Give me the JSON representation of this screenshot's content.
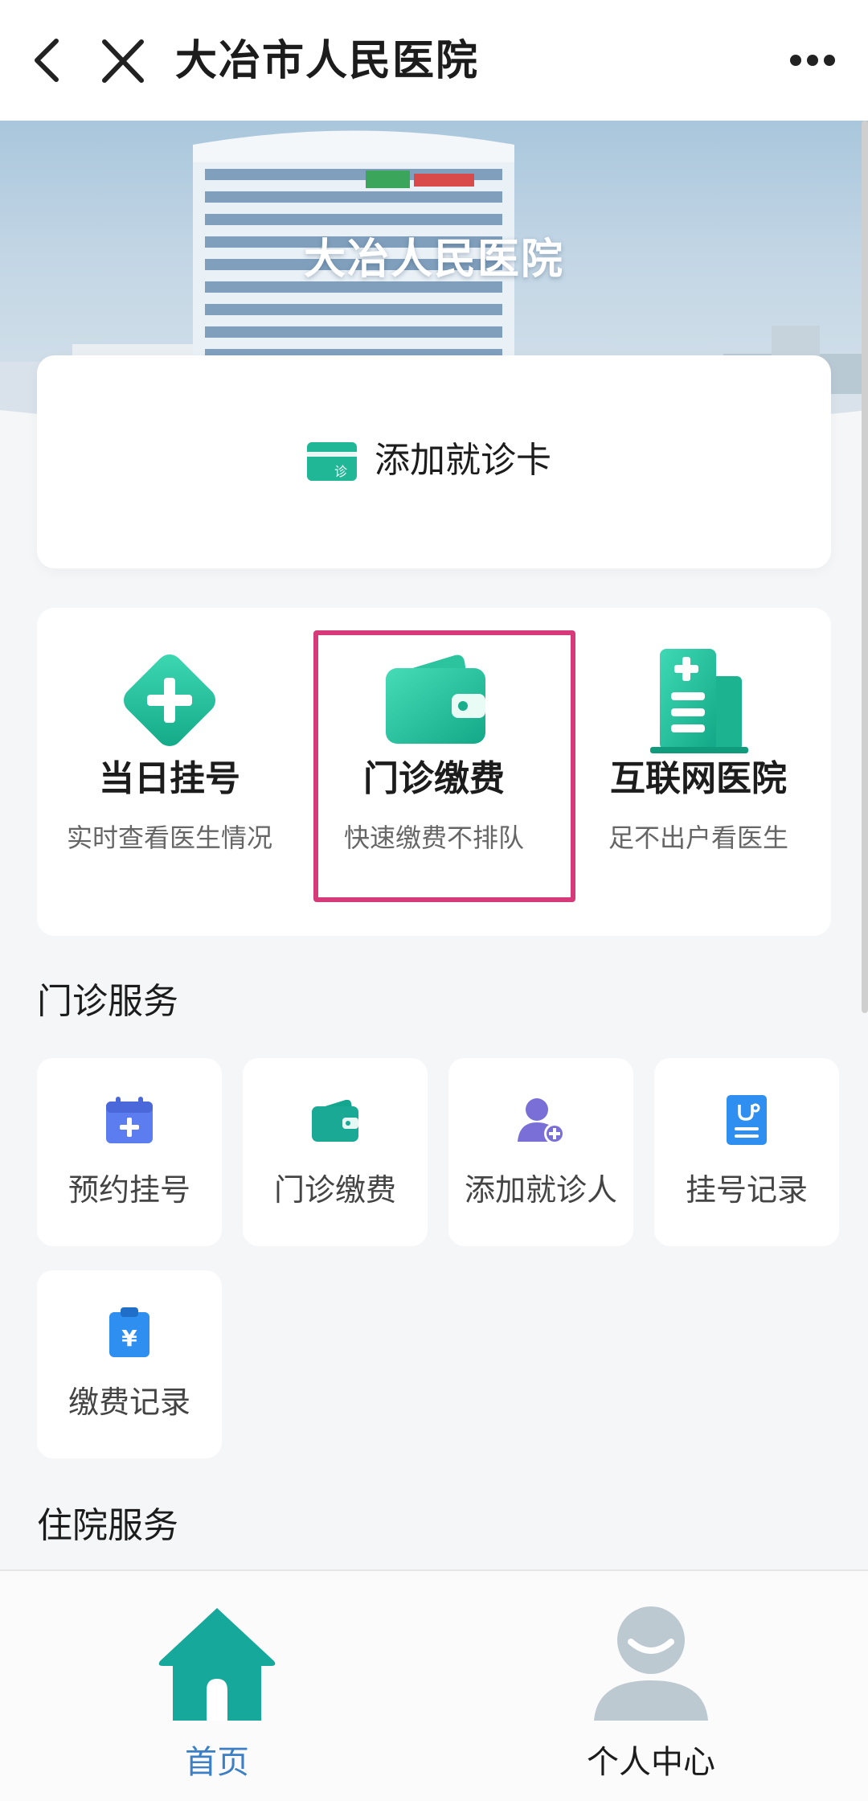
{
  "header": {
    "title": "大冶市人民医院",
    "back_icon": "chevron-left-icon",
    "close_icon": "close-icon",
    "more_icon": "more-dots-icon"
  },
  "banner": {
    "title": "大冶人民医院"
  },
  "add_card": {
    "label": "添加就诊卡",
    "icon_text": "诊"
  },
  "quick_services": [
    {
      "title": "当日挂号",
      "subtitle": "实时查看医生情况",
      "icon": "plus-diamond-icon"
    },
    {
      "title": "门诊缴费",
      "subtitle": "快速缴费不排队",
      "icon": "wallet-icon"
    },
    {
      "title": "互联网医院",
      "subtitle": "足不出户看医生",
      "icon": "hospital-building-icon"
    }
  ],
  "outpatient": {
    "title": "门诊服务",
    "items": [
      {
        "label": "预约挂号",
        "icon": "calendar-plus-icon"
      },
      {
        "label": "门诊缴费",
        "icon": "wallet-icon"
      },
      {
        "label": "添加就诊人",
        "icon": "add-person-icon"
      },
      {
        "label": "挂号记录",
        "icon": "medical-record-icon"
      },
      {
        "label": "缴费记录",
        "icon": "payment-record-icon"
      }
    ]
  },
  "inpatient": {
    "title": "住院服务"
  },
  "bottom_nav": {
    "home": "首页",
    "me": "个人中心"
  },
  "colors": {
    "accent_teal": "#22b79a",
    "highlight": "#d63a78",
    "nav_active": "#3d7fc4"
  }
}
